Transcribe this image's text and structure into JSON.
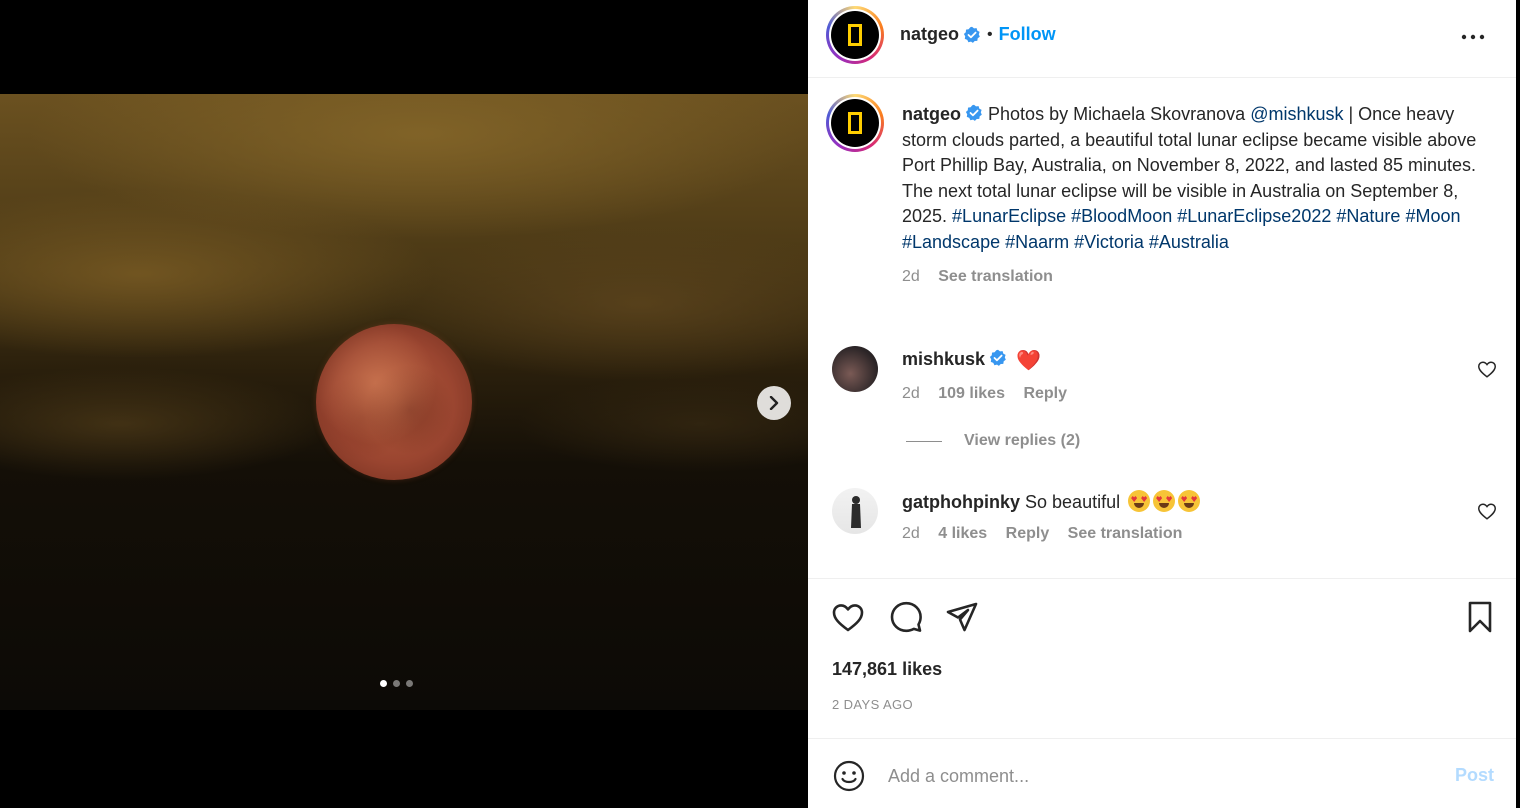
{
  "post": {
    "author": "natgeo",
    "follow_label": "Follow",
    "more_icon": "more-horizontal-icon",
    "image_dots": 3,
    "active_dot": 1
  },
  "caption": {
    "author": "natgeo",
    "text_before_mention": "Photos by Michaela Skovranova ",
    "mention": "@mishkusk",
    "text_after_mention": " | Once heavy storm clouds parted, a beautiful total lunar eclipse became visible above Port Phillip Bay, Australia, on November 8, 2022, and lasted 85 minutes. The next total lunar eclipse will be visible in Australia on September 8, 2025. ",
    "hashtags": [
      "#LunarEclipse",
      "#BloodMoon",
      "#LunarEclipse2022",
      "#Nature",
      "#Moon",
      "#Landscape",
      "#Naarm",
      "#Victoria",
      "#Australia"
    ],
    "time": "2d",
    "see_translation": "See translation"
  },
  "comments": [
    {
      "user": "mishkusk",
      "text": "❤️",
      "time": "2d",
      "likes": "109 likes",
      "reply": "Reply",
      "view_replies": "View replies (2)"
    },
    {
      "user": "gatphohpinky",
      "text": "So beautiful",
      "time": "2d",
      "likes": "4 likes",
      "reply": "Reply",
      "see_translation": "See translation"
    }
  ],
  "engagement": {
    "likes": "147,861 likes",
    "time_ago": "2 DAYS AGO"
  },
  "comment_box": {
    "placeholder": "Add a comment...",
    "post_label": "Post"
  },
  "colors": {
    "link_blue": "#0095f6",
    "hashtag": "#00376b",
    "muted": "#8e8e8e",
    "post_disabled": "#b3dbff"
  }
}
